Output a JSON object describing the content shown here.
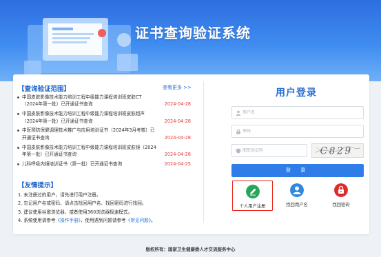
{
  "banner": {
    "title": "证书查询验证系统"
  },
  "scope": {
    "heading": "【查询验证范围】",
    "more": "查看更多 >>",
    "items": [
      {
        "text": "中国皮肤影像技术能力培训工程中级能力课程培训班皮肤CT（2024年第一批）已开通证书查询",
        "date": "2024-04-28"
      },
      {
        "text": "中国皮肤影像技术能力培训工程中级能力课程培训班皮肤超声（2024年第一批）已开通证书查询",
        "date": "2024-04-28"
      },
      {
        "text": "中医预防保健调理技术推广与应用培训证书（2024年3月考核）已开通证书查询",
        "date": "2024-04-28"
      },
      {
        "text": "中国皮肤影像技术能力培训工程中级能力课程培训班皮肤镜（2024年第一批）已开通证书查询",
        "date": "2024-04-28"
      },
      {
        "text": "儿科呼吸内镜培训证书（第一批）已开通证书查询",
        "date": "2024-04-25"
      }
    ]
  },
  "tips": {
    "heading": "【友情提示】",
    "items": [
      {
        "text": "1. 未注册过的用户，请先进行用户注册。"
      },
      {
        "text": "2. 忘记用户名或密码，请点击找回用户名、找回密码进行找回。"
      },
      {
        "text": "3. 建议使用谷歌浏览器，或者使用360浏览器极速模式。"
      },
      {
        "pre": "4. 系统使用请参考",
        "link1": "《操作手册》",
        "mid": "，使用遇到问题请参考",
        "link2": "《常见问题》",
        "post": "。"
      }
    ]
  },
  "login": {
    "title": "用户登录",
    "username_placeholder": "用户名",
    "password_placeholder": "密码",
    "captcha_placeholder": "图形验证码",
    "captcha_text": "C829",
    "button": "登 录",
    "actions": {
      "register": "个人用户注册",
      "find_username": "找回用户名",
      "find_password": "找回密码"
    }
  },
  "colors": {
    "register": "#26a65b",
    "find_username": "#2f87e0",
    "find_password": "#e02b2b",
    "accent": "#2f7de9"
  },
  "footer": "版权所有：国家卫生健康委人才交流服务中心"
}
